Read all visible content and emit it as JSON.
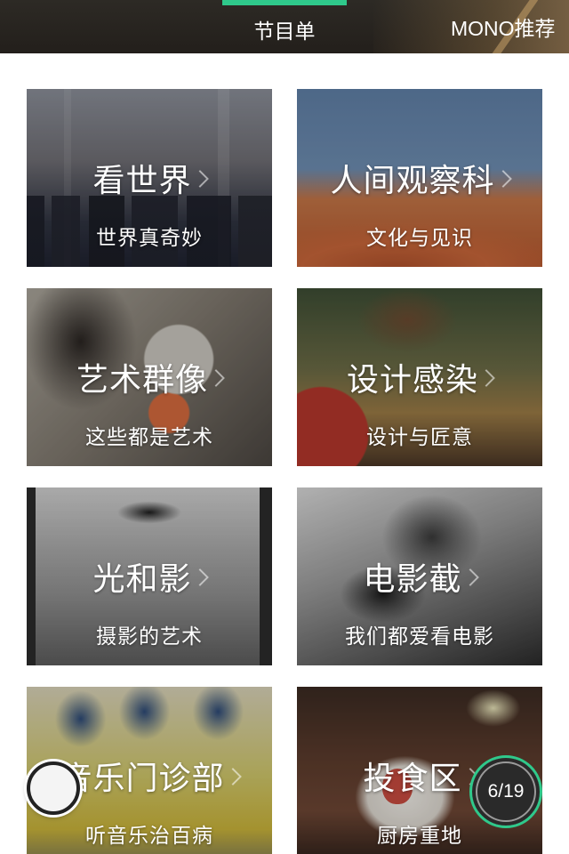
{
  "tabs": {
    "program_list": "节目单",
    "mono_recommend": "MONO推荐"
  },
  "accent_color": "#2fc98b",
  "cards": [
    {
      "title": "看世界",
      "subtitle": "世界真奇妙",
      "icon": "chevron-right-icon"
    },
    {
      "title": "人间观察科",
      "subtitle": "文化与见识",
      "icon": "chevron-right-icon"
    },
    {
      "title": "艺术群像",
      "subtitle": "这些都是艺术",
      "icon": "chevron-right-icon"
    },
    {
      "title": "设计感染",
      "subtitle": "设计与匠意",
      "icon": "chevron-right-icon"
    },
    {
      "title": "光和影",
      "subtitle": "摄影的艺术",
      "icon": "chevron-right-icon"
    },
    {
      "title": "电影截",
      "subtitle": "我们都爱看电影",
      "icon": "chevron-right-icon"
    },
    {
      "title": "音乐门诊部",
      "subtitle": "听音乐治百病",
      "icon": "chevron-right-icon"
    },
    {
      "title": "投食区",
      "subtitle": "厨房重地",
      "icon": "chevron-right-icon"
    }
  ],
  "page_indicator": "6/19"
}
